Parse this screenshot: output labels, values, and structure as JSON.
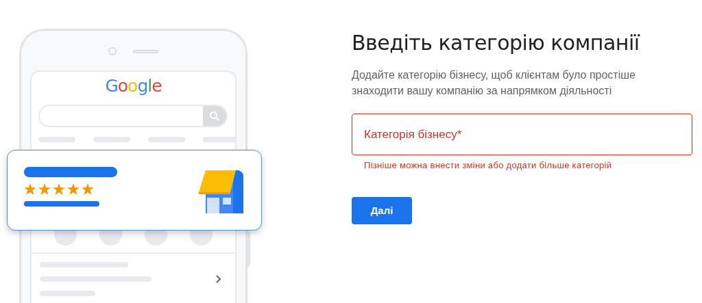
{
  "illustration": {
    "logo": "Google",
    "listing": {
      "stars": 5
    }
  },
  "heading": "Введіть категорію компанії",
  "description": "Додайте категорію бізнесу, щоб клієнтам було простіше знаходити вашу компанію за напрямком діяльності",
  "category_field": {
    "placeholder": "Категорія бізнесу*",
    "error": true
  },
  "helper_text": "Пізніше можна внести зміни або додати більше категорій",
  "buttons": [
    {
      "label": "Далі",
      "kind": "primary"
    }
  ]
}
